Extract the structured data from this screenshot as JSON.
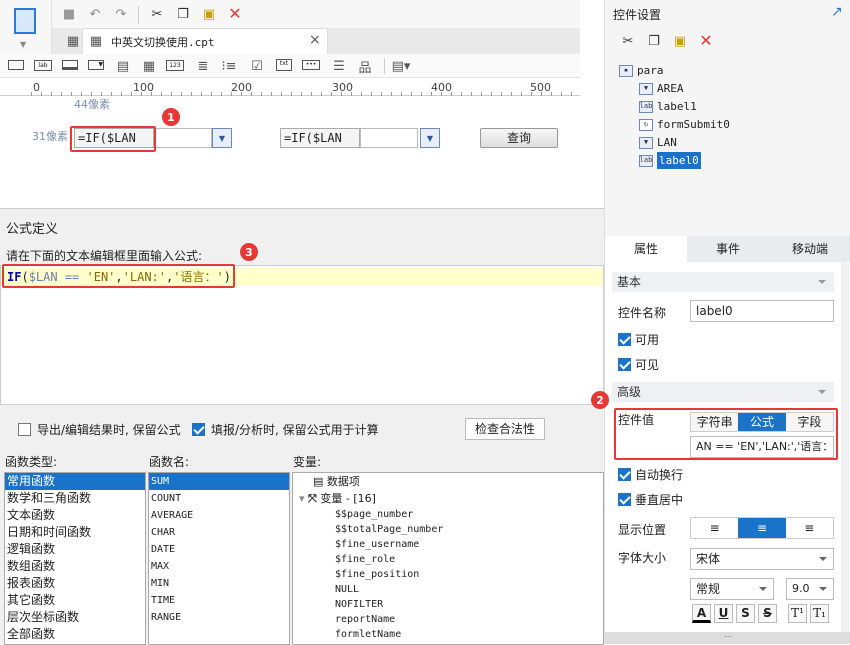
{
  "designer": {
    "file_tab": "中英文切换使用.cpt",
    "tab_close": "×",
    "ruler_ticks": [
      "0",
      "100",
      "200",
      "300",
      "400",
      "500"
    ],
    "canvas": {
      "label_top": "44像素",
      "label_left": "31像素",
      "text1": "=IF($LAN",
      "text2": "=IF($LAN",
      "query_button": "查询"
    },
    "toolbar_icons": [
      "save-icon",
      "undo-icon",
      "redo-icon",
      "cut-icon",
      "copy-icon",
      "paste-icon",
      "delete-icon"
    ]
  },
  "formula": {
    "title": "公式定义",
    "prompt": "请在下面的文本编辑框里面输入公式:",
    "expression": {
      "func": "IF",
      "open": "(",
      "param": "$LAN",
      "op": " == ",
      "str1": "'EN'",
      "comma1": ",",
      "str2": "'LAN:'",
      "comma2": ",",
      "str3": "'语言：'",
      "close": ")"
    },
    "option_keep_export": "导出/编辑结果时, 保留公式",
    "option_keep_fill": "填报/分析时, 保留公式用于计算",
    "check_button": "检查合法性",
    "func_type_label": "函数类型:",
    "func_name_label": "函数名:",
    "var_label": "变量:",
    "func_types": [
      "常用函数",
      "数学和三角函数",
      "文本函数",
      "日期和时间函数",
      "逻辑函数",
      "数组函数",
      "报表函数",
      "其它函数",
      "层次坐标函数",
      "全部函数"
    ],
    "func_names": [
      "SUM",
      "COUNT",
      "AVERAGE",
      "CHAR",
      "DATE",
      "MAX",
      "MIN",
      "TIME",
      "RANGE"
    ],
    "vars_root1": "数据项",
    "vars_root2": "变量 - [16]",
    "vars": [
      "$$page_number",
      "$$totalPage_number",
      "$fine_username",
      "$fine_role",
      "$fine_position",
      "NULL",
      "NOFILTER",
      "reportName",
      "formletName"
    ]
  },
  "panel": {
    "title": "控件设置",
    "tree": [
      "para",
      "AREA",
      "label1",
      "formSubmit0",
      "LAN",
      "label0"
    ],
    "tabs": [
      "属性",
      "事件",
      "移动端"
    ],
    "section_basic": "基本",
    "name_label": "控件名称",
    "name_value": "label0",
    "enabled": "可用",
    "visible": "可见",
    "section_adv": "高级",
    "value_label": "控件值",
    "value_modes": [
      "字符串",
      "公式",
      "字段"
    ],
    "value_text": "AN == 'EN','LAN:','语言：')",
    "wrap": "自动换行",
    "vcenter": "垂直居中",
    "display_pos": "显示位置",
    "font_size_label": "字体大小",
    "font_name": "宋体",
    "font_style": "常规",
    "font_size": "9.0",
    "fmt_buttons": [
      "A",
      "U",
      "S",
      "S",
      "T¹",
      "T₁"
    ]
  },
  "badges": [
    "1",
    "2",
    "3"
  ],
  "colors": {
    "accent": "#1a73c9",
    "highlight": "#e53935",
    "editor_bg": "#ffffcc"
  }
}
